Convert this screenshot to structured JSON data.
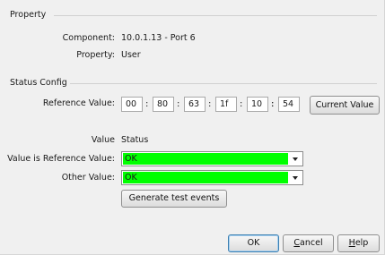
{
  "property_section": {
    "title": "Property",
    "component_label": "Component:",
    "component_value": "10.0.1.13 - Port 6",
    "property_label": "Property:",
    "property_value": "User"
  },
  "status_config": {
    "title": "Status Config",
    "reference_label": "Reference Value:",
    "reference_octets": [
      "00",
      "80",
      "63",
      "1f",
      "10",
      "54"
    ],
    "separator": ":",
    "current_value_button": "Current Value",
    "value_header": "Value",
    "status_header": "Status",
    "rows": [
      {
        "label": "Value is Reference Value:",
        "status": "OK",
        "color": "#00ff00"
      },
      {
        "label": "Other Value:",
        "status": "OK",
        "color": "#00ff00"
      }
    ],
    "generate_button": "Generate test events"
  },
  "footer": {
    "ok": "OK",
    "cancel_prefix": "",
    "cancel_mnemonic": "C",
    "cancel_rest": "ancel",
    "help_mnemonic": "H",
    "help_rest": "elp"
  }
}
